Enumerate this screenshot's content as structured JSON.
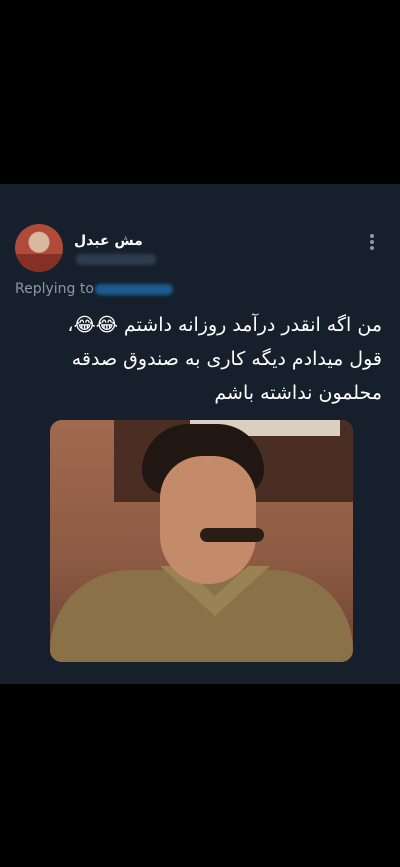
{
  "tweet": {
    "author": {
      "display_name": "مش عبدل"
    },
    "replying_to_label": "Replying to",
    "text_lines": [
      "من اگه انقدر درآمد روزانه داشتم 😂😂،",
      "قول میدادم دیگه کاری به صندوق صدقه",
      "محلمون نداشته باشم"
    ],
    "media": {
      "description_icon": "photo"
    }
  },
  "colors": {
    "page_background": "#000000",
    "card_background": "#16202c",
    "primary_text": "#ffffff",
    "secondary_text": "#8b98a5",
    "link": "#1d9bf0"
  }
}
